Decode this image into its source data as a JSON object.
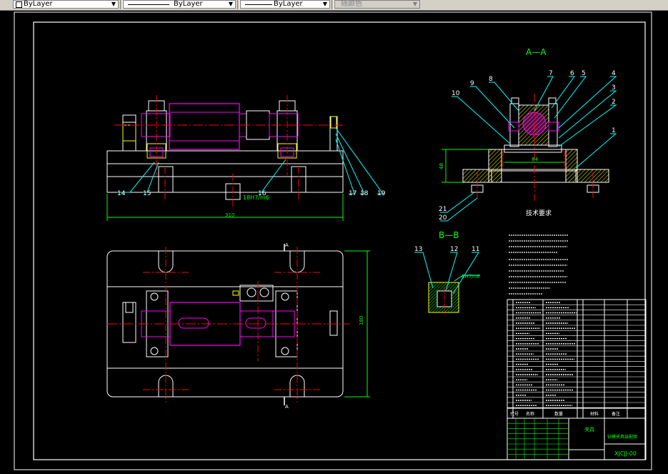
{
  "toolbar": {
    "layer_combo": {
      "value": "ByLayer"
    },
    "linetype_combo": {
      "value": "ByLayer"
    },
    "lineweight_combo": {
      "value": "ByLayer"
    },
    "plotstyle_combo": {
      "value": "随颜色"
    }
  },
  "drawing": {
    "section_aa_label": "A—A",
    "section_bb_label": "B—B",
    "front_view": {
      "dim_length": "310",
      "fit_label": "18H7/m6",
      "balloons": [
        "14",
        "15",
        "16",
        "17",
        "18",
        "19"
      ]
    },
    "plan_view": {
      "dim_height": "180",
      "section_mark_a": "A"
    },
    "section_aa": {
      "dim_width": "84",
      "dim_height": "48",
      "balloons": [
        "1",
        "2",
        "3",
        "4",
        "5",
        "6",
        "7",
        "8",
        "9",
        "10",
        "21",
        "20"
      ]
    },
    "section_bb": {
      "fit_label": "8H7/n6",
      "balloons": [
        "13",
        "12",
        "11"
      ]
    },
    "tech_req_title": "技术要求",
    "title_block": {
      "drawing_number": "XJCJJ-00",
      "material_header": "材料",
      "name_header": "名称",
      "qty_header": "数量",
      "code_header": "代号",
      "remark_header": "备注",
      "title_label": "夹具",
      "subtitle_label": "钻模夹具装配图"
    }
  },
  "colors": {
    "background": "#000000",
    "outline": "#ffffff",
    "centerline": "#ff0000",
    "dimension": "#00ff00",
    "leader": "#00ffff",
    "hidden_part": "#ff00ff",
    "hatch": "#ffff00"
  }
}
